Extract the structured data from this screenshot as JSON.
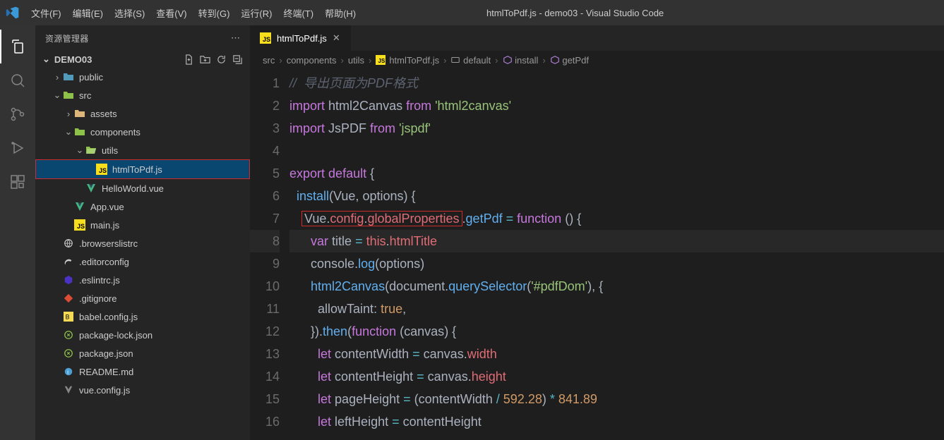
{
  "titlebar": {
    "title": "htmlToPdf.js - demo03 - Visual Studio Code",
    "menu": [
      "文件(F)",
      "编辑(E)",
      "选择(S)",
      "查看(V)",
      "转到(G)",
      "运行(R)",
      "终端(T)",
      "帮助(H)"
    ]
  },
  "sidebar": {
    "title": "资源管理器",
    "section": "DEMO03",
    "tree": [
      {
        "name": "public",
        "icon": "folder-web",
        "depth": 1,
        "arrow": ">"
      },
      {
        "name": "src",
        "icon": "folder-src",
        "depth": 1,
        "arrow": "v"
      },
      {
        "name": "assets",
        "icon": "folder",
        "depth": 2,
        "arrow": ">"
      },
      {
        "name": "components",
        "icon": "folder-comp",
        "depth": 2,
        "arrow": "v"
      },
      {
        "name": "utils",
        "icon": "folder-open",
        "depth": 3,
        "arrow": "v"
      },
      {
        "name": "htmlToPdf.js",
        "icon": "js",
        "depth": 4,
        "selected": true
      },
      {
        "name": "HelloWorld.vue",
        "icon": "vue",
        "depth": 3
      },
      {
        "name": "App.vue",
        "icon": "vue",
        "depth": 2
      },
      {
        "name": "main.js",
        "icon": "js",
        "depth": 2
      },
      {
        "name": ".browserslistrc",
        "icon": "browsers",
        "depth": 1
      },
      {
        "name": ".editorconfig",
        "icon": "editorconfig",
        "depth": 1
      },
      {
        "name": ".eslintrc.js",
        "icon": "eslint",
        "depth": 1
      },
      {
        "name": ".gitignore",
        "icon": "git",
        "depth": 1
      },
      {
        "name": "babel.config.js",
        "icon": "babel",
        "depth": 1
      },
      {
        "name": "package-lock.json",
        "icon": "npm",
        "depth": 1
      },
      {
        "name": "package.json",
        "icon": "npm",
        "depth": 1
      },
      {
        "name": "README.md",
        "icon": "readme",
        "depth": 1
      },
      {
        "name": "vue.config.js",
        "icon": "vueconf",
        "depth": 1
      }
    ]
  },
  "tabs": {
    "active": "htmlToPdf.js"
  },
  "breadcrumbs": [
    "src",
    "components",
    "utils",
    "htmlToPdf.js",
    "default",
    "install",
    "getPdf"
  ],
  "editor": {
    "active_line": 8,
    "lines": [
      {
        "n": 1,
        "raw": "// 导出页面为PDF格式"
      },
      {
        "n": 2,
        "raw": "import html2Canvas from 'html2canvas'"
      },
      {
        "n": 3,
        "raw": "import JsPDF from 'jspdf'"
      },
      {
        "n": 4,
        "raw": ""
      },
      {
        "n": 5,
        "raw": "export default {"
      },
      {
        "n": 6,
        "raw": "  install(Vue, options) {"
      },
      {
        "n": 7,
        "raw": "    Vue.config.globalProperties.getPdf = function () {"
      },
      {
        "n": 8,
        "raw": "      var title = this.htmlTitle"
      },
      {
        "n": 9,
        "raw": "      console.log(options)"
      },
      {
        "n": 10,
        "raw": "      html2Canvas(document.querySelector('#pdfDom'), {"
      },
      {
        "n": 11,
        "raw": "        allowTaint: true,"
      },
      {
        "n": 12,
        "raw": "      }).then(function (canvas) {"
      },
      {
        "n": 13,
        "raw": "        let contentWidth = canvas.width"
      },
      {
        "n": 14,
        "raw": "        let contentHeight = canvas.height"
      },
      {
        "n": 15,
        "raw": "        let pageHeight = (contentWidth / 592.28) * 841.89"
      },
      {
        "n": 16,
        "raw": "        let leftHeight = contentHeight"
      }
    ]
  }
}
